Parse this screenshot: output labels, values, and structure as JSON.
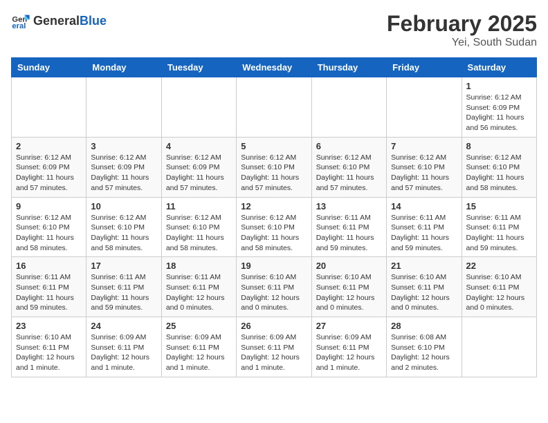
{
  "header": {
    "logo_general": "General",
    "logo_blue": "Blue",
    "month_title": "February 2025",
    "location": "Yei, South Sudan"
  },
  "days_of_week": [
    "Sunday",
    "Monday",
    "Tuesday",
    "Wednesday",
    "Thursday",
    "Friday",
    "Saturday"
  ],
  "weeks": [
    [
      {
        "day": "",
        "info": ""
      },
      {
        "day": "",
        "info": ""
      },
      {
        "day": "",
        "info": ""
      },
      {
        "day": "",
        "info": ""
      },
      {
        "day": "",
        "info": ""
      },
      {
        "day": "",
        "info": ""
      },
      {
        "day": "1",
        "info": "Sunrise: 6:12 AM\nSunset: 6:09 PM\nDaylight: 11 hours and 56 minutes."
      }
    ],
    [
      {
        "day": "2",
        "info": "Sunrise: 6:12 AM\nSunset: 6:09 PM\nDaylight: 11 hours and 57 minutes."
      },
      {
        "day": "3",
        "info": "Sunrise: 6:12 AM\nSunset: 6:09 PM\nDaylight: 11 hours and 57 minutes."
      },
      {
        "day": "4",
        "info": "Sunrise: 6:12 AM\nSunset: 6:09 PM\nDaylight: 11 hours and 57 minutes."
      },
      {
        "day": "5",
        "info": "Sunrise: 6:12 AM\nSunset: 6:10 PM\nDaylight: 11 hours and 57 minutes."
      },
      {
        "day": "6",
        "info": "Sunrise: 6:12 AM\nSunset: 6:10 PM\nDaylight: 11 hours and 57 minutes."
      },
      {
        "day": "7",
        "info": "Sunrise: 6:12 AM\nSunset: 6:10 PM\nDaylight: 11 hours and 57 minutes."
      },
      {
        "day": "8",
        "info": "Sunrise: 6:12 AM\nSunset: 6:10 PM\nDaylight: 11 hours and 58 minutes."
      }
    ],
    [
      {
        "day": "9",
        "info": "Sunrise: 6:12 AM\nSunset: 6:10 PM\nDaylight: 11 hours and 58 minutes."
      },
      {
        "day": "10",
        "info": "Sunrise: 6:12 AM\nSunset: 6:10 PM\nDaylight: 11 hours and 58 minutes."
      },
      {
        "day": "11",
        "info": "Sunrise: 6:12 AM\nSunset: 6:10 PM\nDaylight: 11 hours and 58 minutes."
      },
      {
        "day": "12",
        "info": "Sunrise: 6:12 AM\nSunset: 6:10 PM\nDaylight: 11 hours and 58 minutes."
      },
      {
        "day": "13",
        "info": "Sunrise: 6:11 AM\nSunset: 6:11 PM\nDaylight: 11 hours and 59 minutes."
      },
      {
        "day": "14",
        "info": "Sunrise: 6:11 AM\nSunset: 6:11 PM\nDaylight: 11 hours and 59 minutes."
      },
      {
        "day": "15",
        "info": "Sunrise: 6:11 AM\nSunset: 6:11 PM\nDaylight: 11 hours and 59 minutes."
      }
    ],
    [
      {
        "day": "16",
        "info": "Sunrise: 6:11 AM\nSunset: 6:11 PM\nDaylight: 11 hours and 59 minutes."
      },
      {
        "day": "17",
        "info": "Sunrise: 6:11 AM\nSunset: 6:11 PM\nDaylight: 11 hours and 59 minutes."
      },
      {
        "day": "18",
        "info": "Sunrise: 6:11 AM\nSunset: 6:11 PM\nDaylight: 12 hours and 0 minutes."
      },
      {
        "day": "19",
        "info": "Sunrise: 6:10 AM\nSunset: 6:11 PM\nDaylight: 12 hours and 0 minutes."
      },
      {
        "day": "20",
        "info": "Sunrise: 6:10 AM\nSunset: 6:11 PM\nDaylight: 12 hours and 0 minutes."
      },
      {
        "day": "21",
        "info": "Sunrise: 6:10 AM\nSunset: 6:11 PM\nDaylight: 12 hours and 0 minutes."
      },
      {
        "day": "22",
        "info": "Sunrise: 6:10 AM\nSunset: 6:11 PM\nDaylight: 12 hours and 0 minutes."
      }
    ],
    [
      {
        "day": "23",
        "info": "Sunrise: 6:10 AM\nSunset: 6:11 PM\nDaylight: 12 hours and 1 minute."
      },
      {
        "day": "24",
        "info": "Sunrise: 6:09 AM\nSunset: 6:11 PM\nDaylight: 12 hours and 1 minute."
      },
      {
        "day": "25",
        "info": "Sunrise: 6:09 AM\nSunset: 6:11 PM\nDaylight: 12 hours and 1 minute."
      },
      {
        "day": "26",
        "info": "Sunrise: 6:09 AM\nSunset: 6:11 PM\nDaylight: 12 hours and 1 minute."
      },
      {
        "day": "27",
        "info": "Sunrise: 6:09 AM\nSunset: 6:11 PM\nDaylight: 12 hours and 1 minute."
      },
      {
        "day": "28",
        "info": "Sunrise: 6:08 AM\nSunset: 6:10 PM\nDaylight: 12 hours and 2 minutes."
      },
      {
        "day": "",
        "info": ""
      }
    ]
  ]
}
